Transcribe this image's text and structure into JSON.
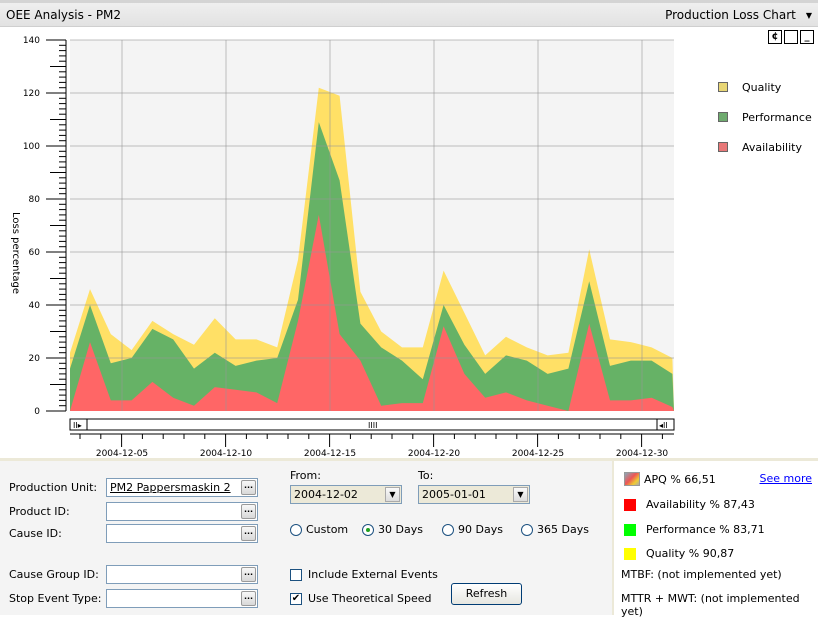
{
  "header": {
    "title": "OEE Analysis - PM2",
    "view_selector": "Production Loss Chart"
  },
  "window_buttons": [
    "refresh-icon",
    "maximize-icon",
    "minimize-icon"
  ],
  "chart_data": {
    "type": "area",
    "stacked": true,
    "title": "",
    "xlabel": "",
    "ylabel": "Loss percentage",
    "ylim": [
      0,
      140
    ],
    "yticks": [
      0,
      20,
      40,
      60,
      80,
      100,
      120,
      140
    ],
    "xtick_labels": [
      "2004-12-05",
      "2004-12-10",
      "2004-12-15",
      "2004-12-20",
      "2004-12-25",
      "2004-12-30"
    ],
    "grid": true,
    "legend_position": "right",
    "series": [
      {
        "name": "Availability",
        "color": "#ff6666",
        "values": [
          0,
          26,
          4,
          4,
          11,
          5,
          2,
          9,
          8,
          7,
          3,
          34,
          74,
          29,
          19,
          2,
          3,
          3,
          32,
          14,
          5,
          7,
          4,
          2,
          0,
          33,
          4,
          4,
          5,
          1.5
        ]
      },
      {
        "name": "Performance",
        "color": "#66b266",
        "values": [
          16,
          14,
          14,
          16,
          20,
          22,
          14,
          13,
          9,
          12,
          17,
          8,
          35,
          58,
          14,
          22,
          16,
          9,
          8,
          11,
          9,
          14,
          15,
          12,
          16,
          16,
          13,
          15,
          14,
          12.5
        ]
      },
      {
        "name": "Quality",
        "color": "#ffe066",
        "values": [
          6,
          6,
          11,
          3,
          3,
          2,
          9,
          13,
          10,
          8,
          4,
          15,
          13,
          32,
          12,
          6,
          5,
          12,
          13,
          12,
          7,
          7,
          5,
          7,
          6,
          12,
          10,
          7,
          5,
          6
        ]
      }
    ],
    "scrollbar_thumb_label": "IIII"
  },
  "legend": [
    {
      "label": "Quality",
      "color": "#e8d675"
    },
    {
      "label": "Performance",
      "color": "#6eaa6e"
    },
    {
      "label": "Availability",
      "color": "#e87878"
    }
  ],
  "filters": {
    "production_unit_label": "Production Unit:",
    "production_unit_value": "PM2 Pappersmaskin 2",
    "product_id_label": "Product ID:",
    "product_id_value": "",
    "cause_id_label": "Cause ID:",
    "cause_id_value": "",
    "cause_group_id_label": "Cause Group ID:",
    "cause_group_id_value": "",
    "stop_event_type_label": "Stop Event Type:",
    "stop_event_type_value": "",
    "browse_label": "...",
    "from_label": "From:",
    "from_value": "2004-12-02",
    "to_label": "To:",
    "to_value": "2005-01-01",
    "ranges": [
      {
        "label": "Custom",
        "selected": false
      },
      {
        "label": "30 Days",
        "selected": true
      },
      {
        "label": "90 Days",
        "selected": false
      },
      {
        "label": "365 Days",
        "selected": false
      }
    ],
    "include_external_label": "Include External Events",
    "include_external_checked": false,
    "theoretical_speed_label": "Use Theoretical Speed",
    "theoretical_speed_checked": true,
    "refresh_label": "Refresh"
  },
  "stats": {
    "see_more": "See more",
    "apq": "APQ %  66,51",
    "availability": "Availability %  87,43",
    "availability_color": "#ff0000",
    "performance": "Performance %  83,71",
    "performance_color": "#00ff00",
    "quality": "Quality %  90,87",
    "quality_color": "#ffff00",
    "mtbf": "MTBF:  (not implemented yet)",
    "mttr": "MTTR + MWT: (not implemented yet)"
  }
}
